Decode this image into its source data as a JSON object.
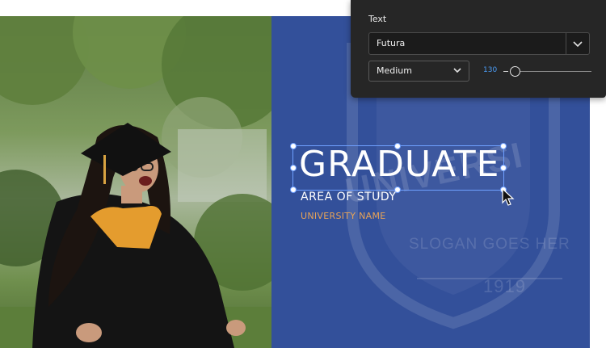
{
  "canvas": {
    "title": "GRADUATE",
    "subtitle": "AREA OF STUDY",
    "university_name": "UNIVERSITY NAME",
    "watermark_univ": "UNIVERSI",
    "watermark_slogan": "SLOGAN GOES HER",
    "watermark_year": "1919"
  },
  "text_panel": {
    "heading": "Text",
    "font_family": "Futura",
    "font_weight": "Medium",
    "font_size": "130",
    "size_slider_fraction": 0.05
  },
  "colors": {
    "background_blue": "#33509a",
    "accent_orange": "#e8a357",
    "selection": "#6fa0ff",
    "panel_bg": "#262626",
    "size_value": "#4b9cf5"
  }
}
